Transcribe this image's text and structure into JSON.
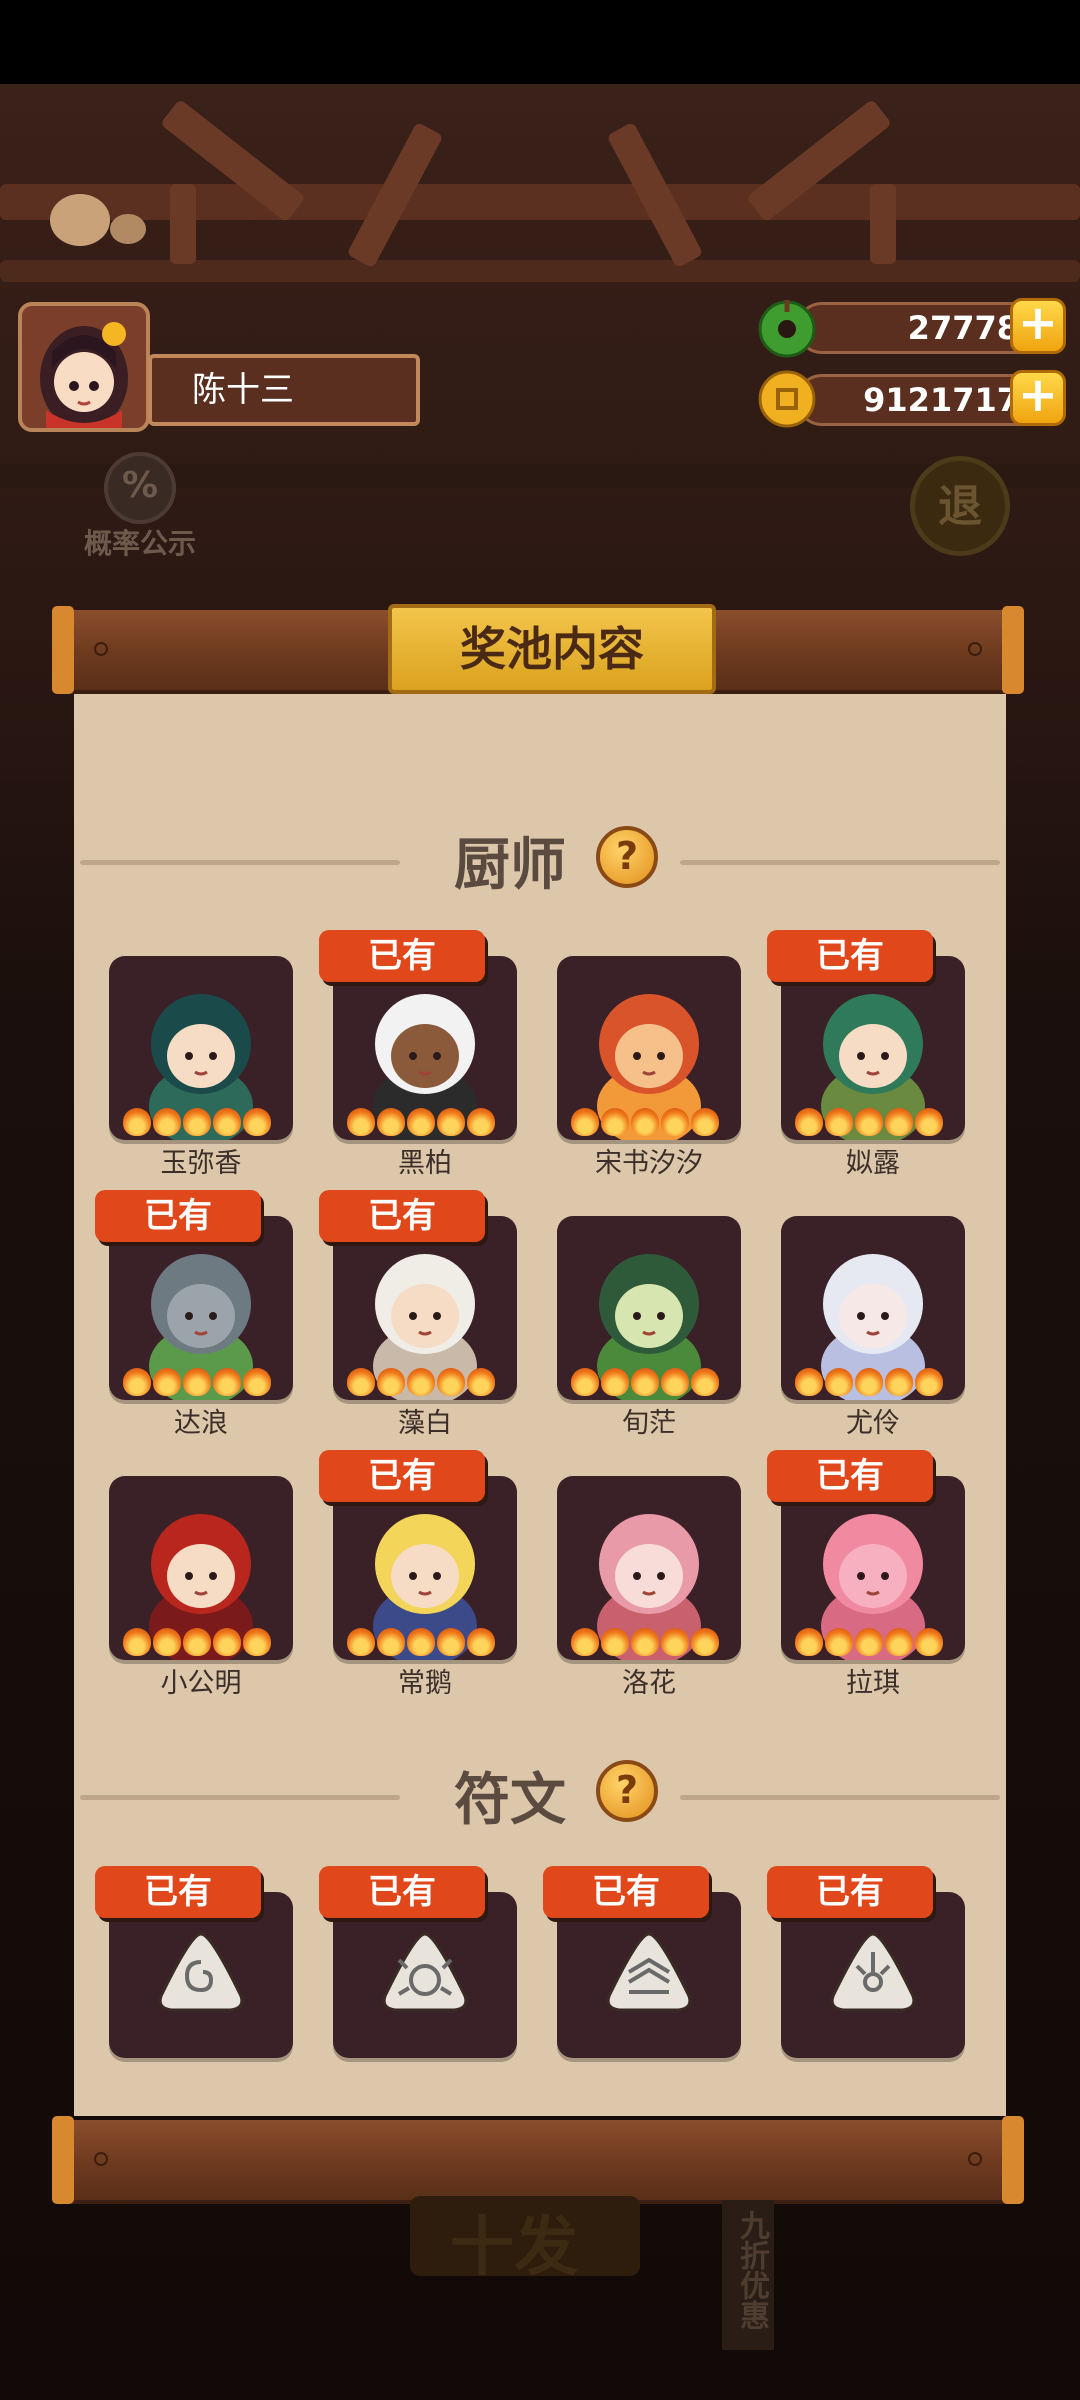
{
  "player": {
    "name": "陈十三"
  },
  "currencies": [
    {
      "icon": "jade-coin-icon",
      "value": "27778"
    },
    {
      "icon": "gold-coin-icon",
      "value": "9121717"
    }
  ],
  "top_buttons": {
    "probability": "概率公示",
    "probability_symbol": "%",
    "exit": "退"
  },
  "panel": {
    "title": "奖池内容",
    "owned_badge": "已有",
    "chef_section": "厨师",
    "rune_section": "符文",
    "help_symbol": "?"
  },
  "chefs": [
    {
      "name": "玉弥香",
      "owned": false
    },
    {
      "name": "黑柏",
      "owned": true
    },
    {
      "name": "宋书汐汐",
      "owned": false
    },
    {
      "name": "姒露",
      "owned": true
    },
    {
      "name": "达浪",
      "owned": true
    },
    {
      "name": "藻白",
      "owned": true
    },
    {
      "name": "旬茫",
      "owned": false
    },
    {
      "name": "尤伶",
      "owned": false
    },
    {
      "name": "小公明",
      "owned": false
    },
    {
      "name": "常鹅",
      "owned": true
    },
    {
      "name": "洛花",
      "owned": false
    },
    {
      "name": "拉琪",
      "owned": true
    }
  ],
  "runes": [
    {
      "icon": "spiral-rune-icon",
      "owned": true
    },
    {
      "icon": "crab-rune-icon",
      "owned": true
    },
    {
      "icon": "wave-rune-icon",
      "owned": true
    },
    {
      "icon": "flower-rune-icon",
      "owned": true
    }
  ],
  "background": {
    "ten_draw": "十发",
    "discount": "九折优惠"
  },
  "colors": {
    "owned_badge": "#e0481b",
    "paper": "#ddc7aa",
    "card": "#3a2127",
    "plaque": "#f3c54b"
  }
}
